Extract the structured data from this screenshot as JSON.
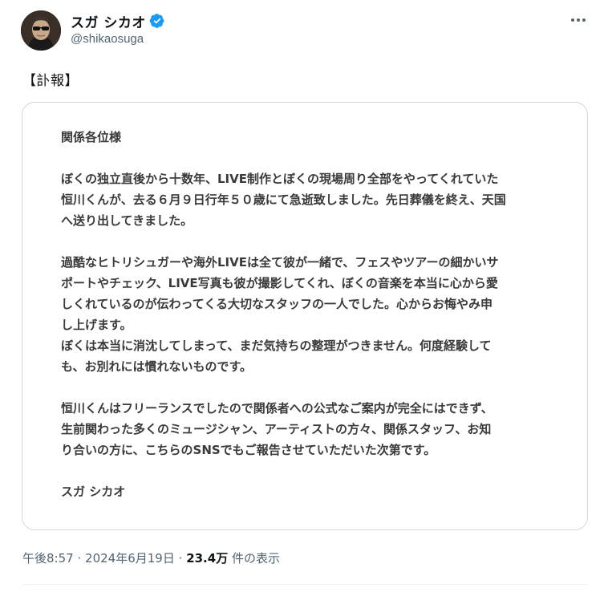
{
  "author": {
    "display_name": "スガ シカオ",
    "handle": "@shikaosuga",
    "verified": true,
    "verified_color": "#1d9bf0"
  },
  "tweet": {
    "text": "【訃報】"
  },
  "notice": {
    "salutation": "関係各位様",
    "paragraph1": "ぼくの独立直後から十数年、LIVE制作とぼくの現場周り全部をやってくれていた\n恒川くんが、去る６月９日行年５０歳にて急逝致しました。先日葬儀を終え、天国\nへ送り出してきました。",
    "paragraph2": "過酷なヒトリシュガーや海外LIVEは全て彼が一緒で、フェスやツアーの細かいサ\nポートやチェック、LIVE写真も彼が撮影してくれ、ぼくの音楽を本当に心から愛\nしくれているのが伝わってくる大切なスタッフの一人でした。心からお悔やみ申\nし上げます。\nぼくは本当に消沈してしまって、まだ気持ちの整理がつきません。何度経験して\nも、お別れには慣れないものです。",
    "paragraph3": "恒川くんはフリーランスでしたので関係者への公式なご案内が完全にはできず、\n生前関わった多くのミュージシャン、アーティストの方々、関係スタッフ、お知\nり合いの方に、こちらのSNSでもご報告させていただいた次第です。",
    "signature": "スガ シカオ"
  },
  "meta": {
    "time": "午後8:57",
    "separator": "·",
    "date": "2024年6月19日",
    "views_count": "23.4万",
    "views_label": "件の表示"
  },
  "icons": {
    "more": "more-options-icon",
    "verified": "verified-badge-icon"
  }
}
